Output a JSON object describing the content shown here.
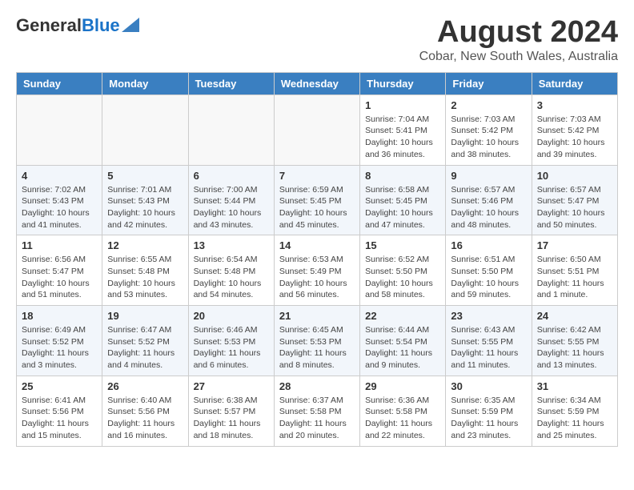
{
  "header": {
    "logo_general": "General",
    "logo_blue": "Blue",
    "month_year": "August 2024",
    "location": "Cobar, New South Wales, Australia"
  },
  "weekdays": [
    "Sunday",
    "Monday",
    "Tuesday",
    "Wednesday",
    "Thursday",
    "Friday",
    "Saturday"
  ],
  "weeks": [
    [
      {
        "day": "",
        "detail": ""
      },
      {
        "day": "",
        "detail": ""
      },
      {
        "day": "",
        "detail": ""
      },
      {
        "day": "",
        "detail": ""
      },
      {
        "day": "1",
        "detail": "Sunrise: 7:04 AM\nSunset: 5:41 PM\nDaylight: 10 hours\nand 36 minutes."
      },
      {
        "day": "2",
        "detail": "Sunrise: 7:03 AM\nSunset: 5:42 PM\nDaylight: 10 hours\nand 38 minutes."
      },
      {
        "day": "3",
        "detail": "Sunrise: 7:03 AM\nSunset: 5:42 PM\nDaylight: 10 hours\nand 39 minutes."
      }
    ],
    [
      {
        "day": "4",
        "detail": "Sunrise: 7:02 AM\nSunset: 5:43 PM\nDaylight: 10 hours\nand 41 minutes."
      },
      {
        "day": "5",
        "detail": "Sunrise: 7:01 AM\nSunset: 5:43 PM\nDaylight: 10 hours\nand 42 minutes."
      },
      {
        "day": "6",
        "detail": "Sunrise: 7:00 AM\nSunset: 5:44 PM\nDaylight: 10 hours\nand 43 minutes."
      },
      {
        "day": "7",
        "detail": "Sunrise: 6:59 AM\nSunset: 5:45 PM\nDaylight: 10 hours\nand 45 minutes."
      },
      {
        "day": "8",
        "detail": "Sunrise: 6:58 AM\nSunset: 5:45 PM\nDaylight: 10 hours\nand 47 minutes."
      },
      {
        "day": "9",
        "detail": "Sunrise: 6:57 AM\nSunset: 5:46 PM\nDaylight: 10 hours\nand 48 minutes."
      },
      {
        "day": "10",
        "detail": "Sunrise: 6:57 AM\nSunset: 5:47 PM\nDaylight: 10 hours\nand 50 minutes."
      }
    ],
    [
      {
        "day": "11",
        "detail": "Sunrise: 6:56 AM\nSunset: 5:47 PM\nDaylight: 10 hours\nand 51 minutes."
      },
      {
        "day": "12",
        "detail": "Sunrise: 6:55 AM\nSunset: 5:48 PM\nDaylight: 10 hours\nand 53 minutes."
      },
      {
        "day": "13",
        "detail": "Sunrise: 6:54 AM\nSunset: 5:48 PM\nDaylight: 10 hours\nand 54 minutes."
      },
      {
        "day": "14",
        "detail": "Sunrise: 6:53 AM\nSunset: 5:49 PM\nDaylight: 10 hours\nand 56 minutes."
      },
      {
        "day": "15",
        "detail": "Sunrise: 6:52 AM\nSunset: 5:50 PM\nDaylight: 10 hours\nand 58 minutes."
      },
      {
        "day": "16",
        "detail": "Sunrise: 6:51 AM\nSunset: 5:50 PM\nDaylight: 10 hours\nand 59 minutes."
      },
      {
        "day": "17",
        "detail": "Sunrise: 6:50 AM\nSunset: 5:51 PM\nDaylight: 11 hours\nand 1 minute."
      }
    ],
    [
      {
        "day": "18",
        "detail": "Sunrise: 6:49 AM\nSunset: 5:52 PM\nDaylight: 11 hours\nand 3 minutes."
      },
      {
        "day": "19",
        "detail": "Sunrise: 6:47 AM\nSunset: 5:52 PM\nDaylight: 11 hours\nand 4 minutes."
      },
      {
        "day": "20",
        "detail": "Sunrise: 6:46 AM\nSunset: 5:53 PM\nDaylight: 11 hours\nand 6 minutes."
      },
      {
        "day": "21",
        "detail": "Sunrise: 6:45 AM\nSunset: 5:53 PM\nDaylight: 11 hours\nand 8 minutes."
      },
      {
        "day": "22",
        "detail": "Sunrise: 6:44 AM\nSunset: 5:54 PM\nDaylight: 11 hours\nand 9 minutes."
      },
      {
        "day": "23",
        "detail": "Sunrise: 6:43 AM\nSunset: 5:55 PM\nDaylight: 11 hours\nand 11 minutes."
      },
      {
        "day": "24",
        "detail": "Sunrise: 6:42 AM\nSunset: 5:55 PM\nDaylight: 11 hours\nand 13 minutes."
      }
    ],
    [
      {
        "day": "25",
        "detail": "Sunrise: 6:41 AM\nSunset: 5:56 PM\nDaylight: 11 hours\nand 15 minutes."
      },
      {
        "day": "26",
        "detail": "Sunrise: 6:40 AM\nSunset: 5:56 PM\nDaylight: 11 hours\nand 16 minutes."
      },
      {
        "day": "27",
        "detail": "Sunrise: 6:38 AM\nSunset: 5:57 PM\nDaylight: 11 hours\nand 18 minutes."
      },
      {
        "day": "28",
        "detail": "Sunrise: 6:37 AM\nSunset: 5:58 PM\nDaylight: 11 hours\nand 20 minutes."
      },
      {
        "day": "29",
        "detail": "Sunrise: 6:36 AM\nSunset: 5:58 PM\nDaylight: 11 hours\nand 22 minutes."
      },
      {
        "day": "30",
        "detail": "Sunrise: 6:35 AM\nSunset: 5:59 PM\nDaylight: 11 hours\nand 23 minutes."
      },
      {
        "day": "31",
        "detail": "Sunrise: 6:34 AM\nSunset: 5:59 PM\nDaylight: 11 hours\nand 25 minutes."
      }
    ]
  ]
}
